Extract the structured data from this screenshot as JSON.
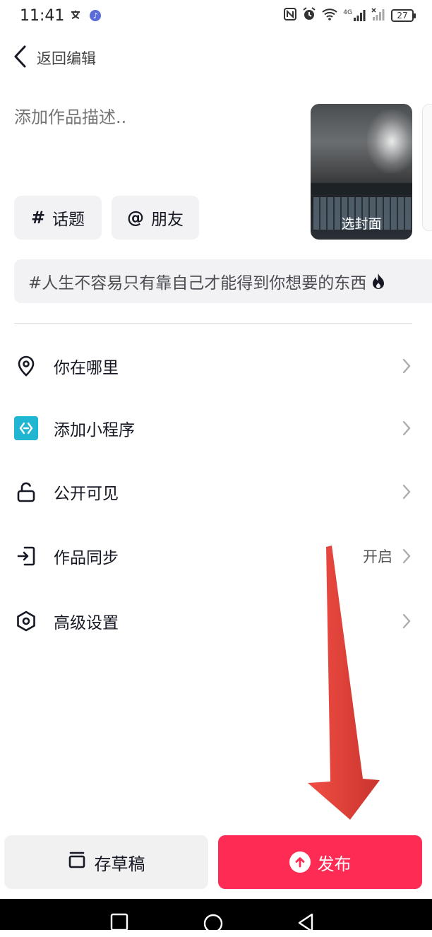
{
  "status_bar": {
    "time": "11:41",
    "left_icons": [
      "translate-icon",
      "music-icon"
    ],
    "right_icons": [
      "nfc-icon",
      "alarm-icon",
      "wifi-icon",
      "signal-4g-icon",
      "signal-icon"
    ],
    "network": "4G",
    "battery": "27"
  },
  "header": {
    "back_label": "返回编辑"
  },
  "description": {
    "placeholder": "添加作品描述.."
  },
  "cover": {
    "label": "选封面"
  },
  "chips": [
    {
      "symbol": "#",
      "label": "话题"
    },
    {
      "symbol": "@",
      "label": "朋友"
    }
  ],
  "suggested_topic": {
    "text": "#人生不容易只有靠自己才能得到你想要的东西",
    "icon": "fire-icon"
  },
  "settings": [
    {
      "icon": "location-pin-icon",
      "label": "你在哪里",
      "value": ""
    },
    {
      "icon": "mini-program-icon",
      "label": "添加小程序",
      "value": ""
    },
    {
      "icon": "unlock-icon",
      "label": "公开可见",
      "value": ""
    },
    {
      "icon": "sync-icon",
      "label": "作品同步",
      "value": "开启"
    },
    {
      "icon": "hexagon-settings-icon",
      "label": "高级设置",
      "value": ""
    }
  ],
  "footer": {
    "draft_label": "存草稿",
    "publish_label": "发布"
  },
  "colors": {
    "accent": "#fe2c55",
    "chip_bg": "#f2f2f4",
    "mini_program": "#20b5d0",
    "annotation_arrow": "#f0443a"
  }
}
